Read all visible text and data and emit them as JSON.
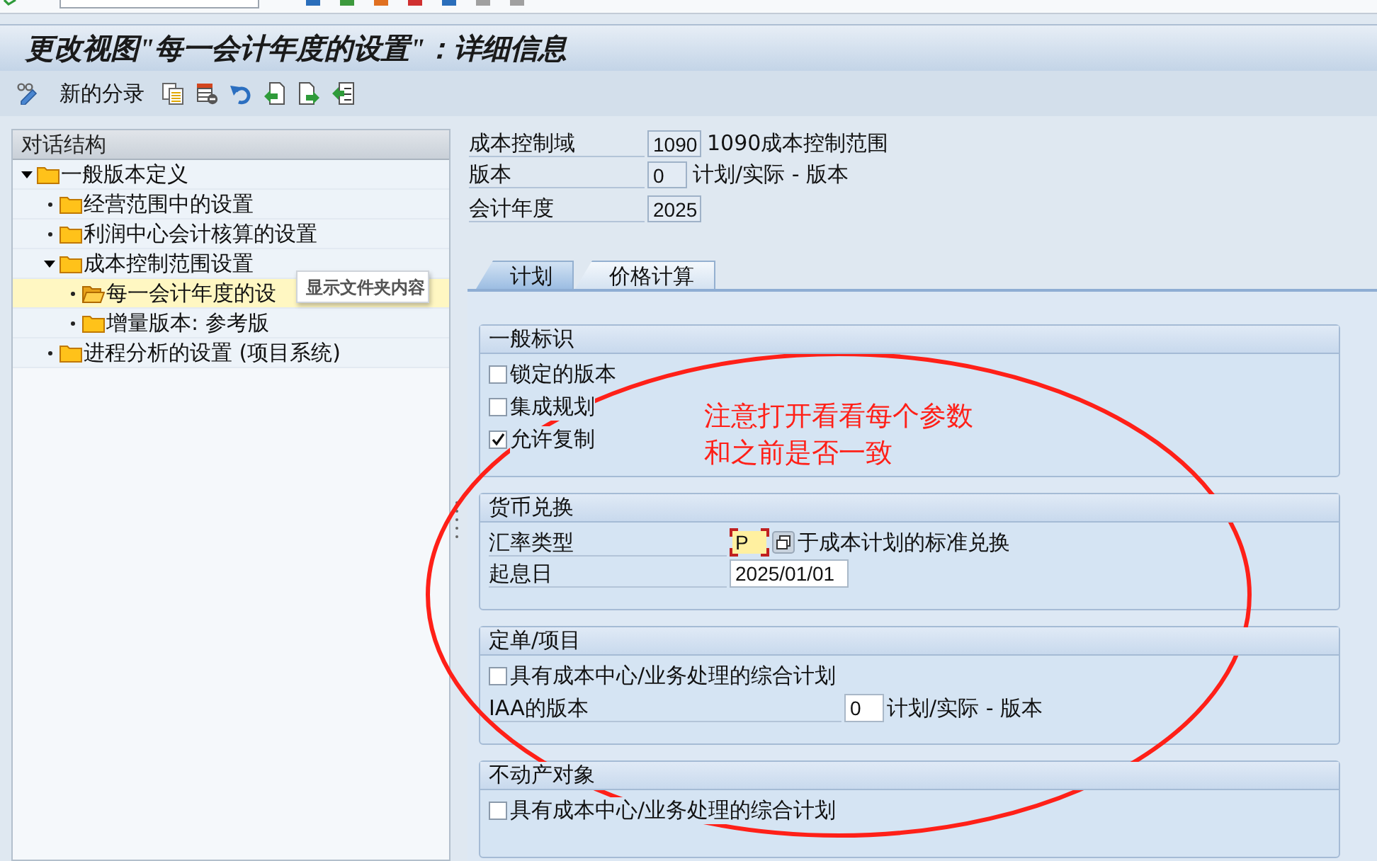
{
  "window": {
    "title": "更改视图\"每一会计年度的设置\"：详细信息"
  },
  "toolbar": {
    "new_entries": "新的分录"
  },
  "dialog_structure": {
    "title": "对话结构",
    "tree": [
      {
        "label": "一般版本定义",
        "expanded": true,
        "selected": false,
        "children": [
          {
            "label": "经营范围中的设置",
            "selected": false
          },
          {
            "label": "利润中心会计核算的设置",
            "selected": false
          },
          {
            "label": "成本控制范围设置",
            "expanded": true,
            "selected": false,
            "children": [
              {
                "label": "每一会计年度的设",
                "selected": true
              },
              {
                "label": "增量版本: 参考版",
                "selected": false
              }
            ]
          },
          {
            "label": "进程分析的设置 (项目系统)",
            "selected": false
          }
        ]
      }
    ]
  },
  "tooltip": {
    "text": "显示文件夹内容"
  },
  "header_fields": [
    {
      "label": "成本控制域",
      "value": "1090",
      "description": "1090成本控制范围"
    },
    {
      "label": "版本",
      "value": "0",
      "description": "计划/实际 - 版本"
    },
    {
      "label": "会计年度",
      "value": "2025"
    }
  ],
  "tabs": [
    {
      "label": "计划",
      "selected": true
    },
    {
      "label": "价格计算",
      "selected": false
    }
  ],
  "groups": [
    {
      "title": "一般标识",
      "rows": [
        {
          "kind": "checkbox",
          "label": "锁定的版本",
          "checked": false
        },
        {
          "kind": "checkbox",
          "label": "集成规划",
          "checked": false
        },
        {
          "kind": "checkbox",
          "label": "允许复制",
          "checked": true
        }
      ]
    },
    {
      "title": "货币兑换",
      "rows": [
        {
          "kind": "field",
          "label": "汇率类型",
          "value": "P",
          "focused": true,
          "value_help": true,
          "description": "于成本计划的标准兑换"
        },
        {
          "kind": "field",
          "label": "起息日",
          "value": "2025/01/01",
          "focused": false,
          "value_help": false
        }
      ]
    },
    {
      "title": "定单/项目",
      "rows": [
        {
          "kind": "checkbox",
          "label": "具有成本中心/业务处理的综合计划",
          "checked": false
        },
        {
          "kind": "field",
          "label": "IAA的版本",
          "value": "0",
          "focused": false,
          "value_help": false,
          "description": "计划/实际 - 版本"
        }
      ]
    },
    {
      "title": "不动产对象",
      "rows": [
        {
          "kind": "checkbox",
          "label": "具有成本中心/业务处理的综合计划",
          "checked": false
        }
      ]
    }
  ],
  "annotation": {
    "lines": [
      "注意打开看看每个参数",
      "和之前是否一致"
    ]
  }
}
